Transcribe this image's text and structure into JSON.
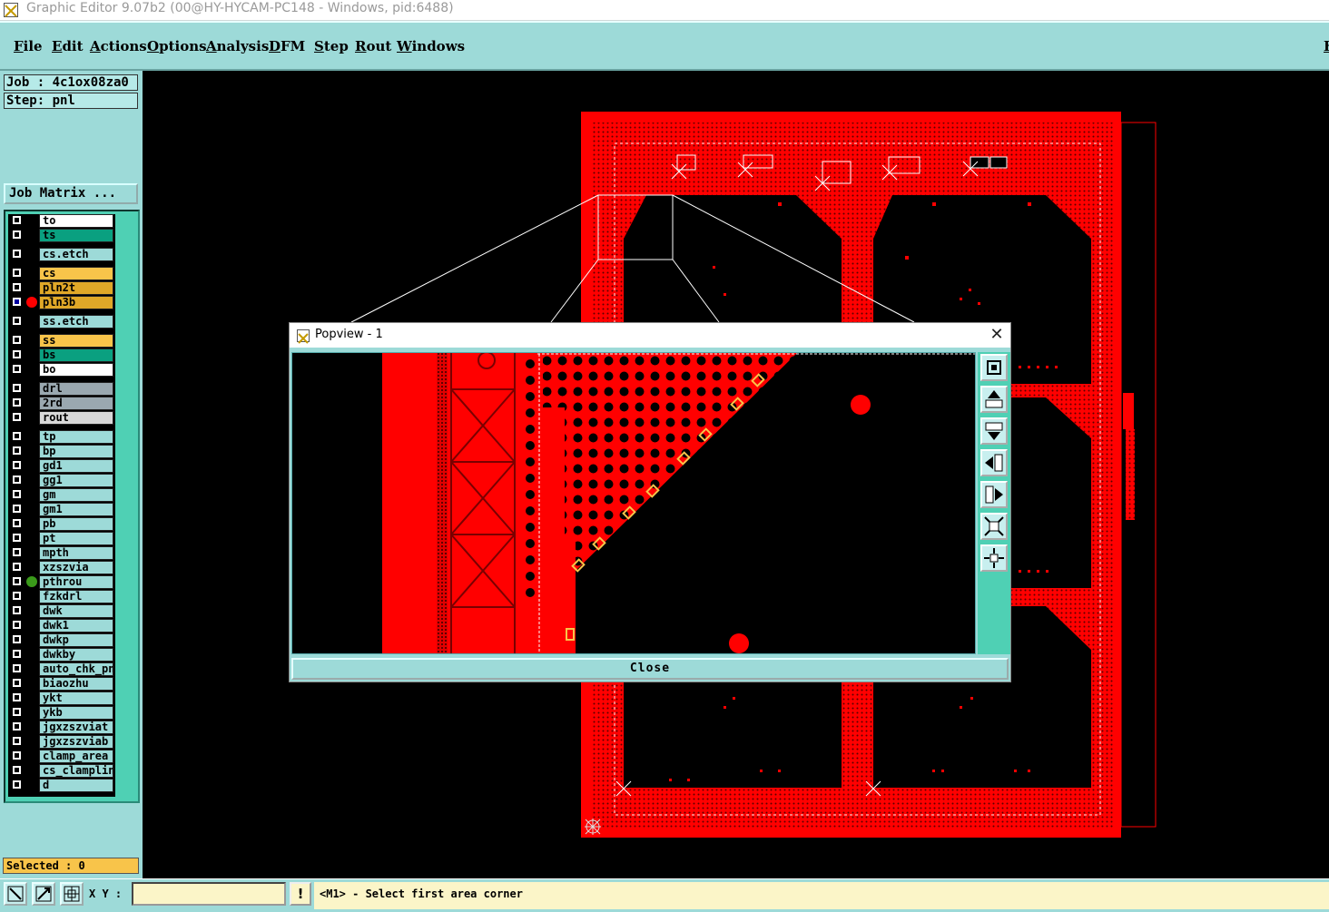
{
  "window": {
    "title": "Graphic Editor 9.07b2 (00@HY-HYCAM-PC148 - Windows, pid:6488)"
  },
  "menu": {
    "items": [
      "File",
      "Edit",
      "Actions",
      "Options",
      "Analysis",
      "DFM",
      "Step",
      "Rout",
      "Windows"
    ],
    "right_label": "H"
  },
  "job": {
    "job_label": "Job : 4c1ox08za0",
    "step_label": "Step: pnl",
    "matrix_button": "Job Matrix ..."
  },
  "layers": [
    {
      "name": "to",
      "color": "#ffffff"
    },
    {
      "name": "ts",
      "color": "#0aa080"
    },
    {
      "name": "cs.etch",
      "color": "#9ddad8"
    },
    {
      "name": "cs",
      "color": "#f8c44a"
    },
    {
      "name": "pln2t",
      "color": "#e0a828"
    },
    {
      "name": "pln3b",
      "color": "#e0a828",
      "work": true,
      "marker": "#ff0000"
    },
    {
      "name": "ss.etch",
      "color": "#9ddad8"
    },
    {
      "name": "ss",
      "color": "#f8c44a"
    },
    {
      "name": "bs",
      "color": "#0aa080"
    },
    {
      "name": "bo",
      "color": "#ffffff"
    },
    {
      "name": "drl",
      "color": "#9aa8b0"
    },
    {
      "name": "2rd",
      "color": "#9aa8b0"
    },
    {
      "name": "rout",
      "color": "#d8d8d8"
    },
    {
      "name": "tp",
      "color": "#9ddad8"
    },
    {
      "name": "bp",
      "color": "#9ddad8"
    },
    {
      "name": "gd1",
      "color": "#9ddad8"
    },
    {
      "name": "gg1",
      "color": "#9ddad8"
    },
    {
      "name": "gm",
      "color": "#9ddad8"
    },
    {
      "name": "gm1",
      "color": "#9ddad8"
    },
    {
      "name": "pb",
      "color": "#9ddad8"
    },
    {
      "name": "pt",
      "color": "#9ddad8"
    },
    {
      "name": "mpth",
      "color": "#9ddad8"
    },
    {
      "name": "xzszvia",
      "color": "#9ddad8"
    },
    {
      "name": "pthrou",
      "color": "#9ddad8",
      "marker": "#3a9a1a"
    },
    {
      "name": "fzkdrl",
      "color": "#9ddad8"
    },
    {
      "name": "dwk",
      "color": "#9ddad8"
    },
    {
      "name": "dwk1",
      "color": "#9ddad8"
    },
    {
      "name": "dwkp",
      "color": "#9ddad8"
    },
    {
      "name": "dwkby",
      "color": "#9ddad8"
    },
    {
      "name": "auto_chk_pnl",
      "color": "#9ddad8"
    },
    {
      "name": "biaozhu",
      "color": "#9ddad8"
    },
    {
      "name": "ykt",
      "color": "#9ddad8"
    },
    {
      "name": "ykb",
      "color": "#9ddad8"
    },
    {
      "name": "jgxzszviat",
      "color": "#9ddad8"
    },
    {
      "name": "jgxzszviab",
      "color": "#9ddad8"
    },
    {
      "name": "clamp_area",
      "color": "#9ddad8"
    },
    {
      "name": "cs_clampline",
      "color": "#9ddad8"
    },
    {
      "name": "d",
      "color": "#9ddad8"
    }
  ],
  "selected": {
    "label": "Selected : 0"
  },
  "bottom": {
    "xy_label": "X Y :",
    "xy_value": "",
    "alert": "!",
    "message": "<M1> - Select first area corner"
  },
  "popup": {
    "title": "Popview - 1",
    "close_label": "Close"
  },
  "colors": {
    "board_red": "#ff0000",
    "panel_teal": "#9ddad8",
    "status_yellow": "#fbf5c8"
  }
}
